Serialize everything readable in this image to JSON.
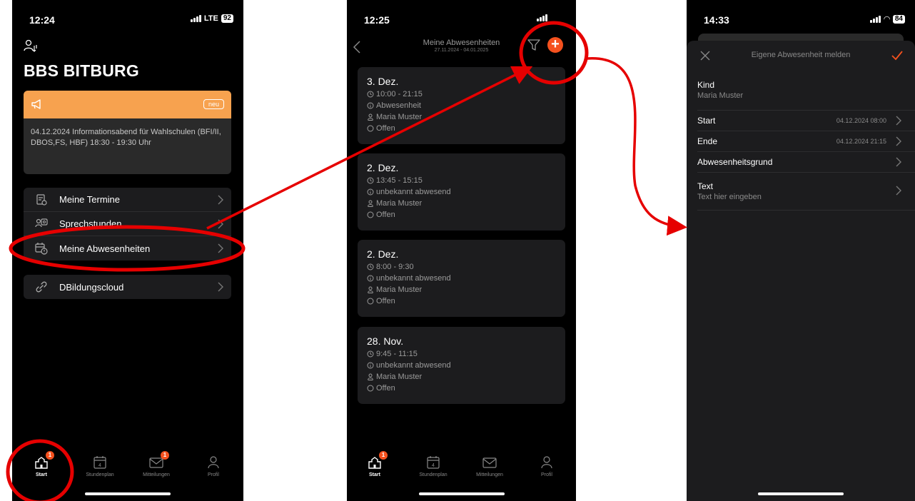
{
  "colors": {
    "accent": "#f5511e",
    "announcement": "#f7a24f",
    "annotation": "#e60000"
  },
  "phone1": {
    "status": {
      "time": "12:24",
      "network": "LTE",
      "battery": "92"
    },
    "school_title": "BBS BITBURG",
    "announcement": {
      "badge": "neu",
      "text": "04.12.2024 Informationsabend für Wahlschulen (BFI/II, DBOS,FS, HBF) 18:30 - 19:30 Uhr"
    },
    "menu": [
      {
        "label": "Meine Termine",
        "icon": "appointments-icon"
      },
      {
        "label": "Sprechstunden",
        "icon": "consultation-icon"
      },
      {
        "label": "Meine Abwesenheiten",
        "icon": "absences-icon"
      }
    ],
    "links": [
      {
        "label": "DBildungscloud",
        "icon": "link-icon"
      }
    ],
    "tabs": [
      {
        "label": "Start",
        "badge": "1",
        "active": true
      },
      {
        "label": "Stundenplan",
        "calendar_day": "4"
      },
      {
        "label": "Mitteilungen",
        "badge": "1"
      },
      {
        "label": "Profil"
      }
    ]
  },
  "phone2": {
    "status": {
      "time": "12:25"
    },
    "header": {
      "title": "Meine Abwesenheiten",
      "range": "27.11.2024 - 04.01.2025",
      "add_label": "+"
    },
    "absences": [
      {
        "date": "3. Dez.",
        "time": "10:00 - 21:15",
        "type": "Abwesenheit",
        "person": "Maria Muster",
        "status": "Offen"
      },
      {
        "date": "2. Dez.",
        "time": "13:45 - 15:15",
        "type": "unbekannt abwesend",
        "person": "Maria Muster",
        "status": "Offen"
      },
      {
        "date": "2. Dez.",
        "time": "8:00 - 9:30",
        "type": "unbekannt abwesend",
        "person": "Maria Muster",
        "status": "Offen"
      },
      {
        "date": "28. Nov.",
        "time": "9:45 - 11:15",
        "type": "unbekannt abwesend",
        "person": "Maria Muster",
        "status": "Offen"
      }
    ],
    "tabs": [
      {
        "label": "Start",
        "badge": "1",
        "active": true
      },
      {
        "label": "Stundenplan",
        "calendar_day": "4"
      },
      {
        "label": "Mitteilungen"
      },
      {
        "label": "Profil"
      }
    ]
  },
  "phone3": {
    "status": {
      "time": "14:33",
      "battery": "84"
    },
    "sheet": {
      "title": "Eigene Abwesenheit melden",
      "child_label": "Kind",
      "child_value": "Maria Muster",
      "start_label": "Start",
      "start_value": "04.12.2024 08:00",
      "end_label": "Ende",
      "end_value": "04.12.2024 21:15",
      "reason_label": "Abwesenheitsgrund",
      "text_label": "Text",
      "text_placeholder": "Text hier eingeben"
    }
  }
}
